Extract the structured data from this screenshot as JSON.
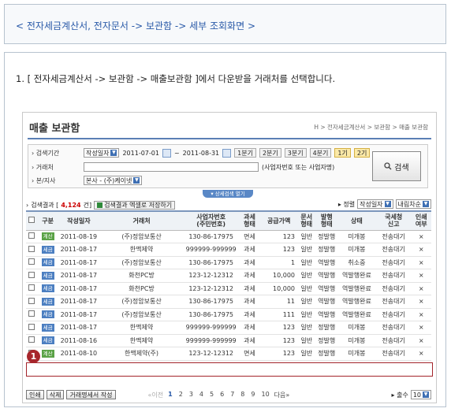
{
  "header": {
    "title": "< 전자세금계산서, 전자문서 -> 보관함 -> 세부 조회화면 >"
  },
  "instruction": "1. [ 전자세금계산서 -> 보관함 -> 매출보관함 ]에서 다운받을 거래처를 선택합니다.",
  "screen": {
    "page_title": "매출 보관함",
    "breadcrumb": "H > 전자세금계산서 > 보관함 > 매출 보관함",
    "search": {
      "period_label": "검색기간",
      "date_type": "작성일자",
      "date_from": "2011-07-01",
      "date_to": "2011-08-31",
      "range_tilde": "~",
      "ranges": [
        "1분기",
        "2분기",
        "3분기",
        "4분기",
        "1기",
        "2기"
      ],
      "partner_label": "거래처",
      "partner_value": "",
      "partner_hint": "(사업자번호 또는 사업자명)",
      "branch_label": "본/지사",
      "branch_value": "본사 - (주)케이넷",
      "search_button": "검색",
      "detail_toggle": "상세검색 열기"
    },
    "result": {
      "prefix": "검색결과 [",
      "count": "4,124",
      "suffix": "건]",
      "excel_button": "검색결과 엑셀로 저장하기",
      "sort_label": "▸ 정렬",
      "sort_value": "작성일자",
      "order_value": "내림차순"
    },
    "columns": [
      "구분",
      "작성일자",
      "거래처",
      "사업자번호\n(주민번호)",
      "과세\n형태",
      "공급가액",
      "문서\n형태",
      "발행\n형태",
      "상태",
      "국세청\n신고",
      "인쇄\n여부"
    ],
    "rows": [
      {
        "type": "계산",
        "type_color": "green",
        "date": "2011-08-19",
        "partner": "(주)정암보통산",
        "bizno": "130-86-17975",
        "tax": "면세",
        "tax_red": true,
        "amount": "123",
        "doc": "일반",
        "issue": "정발행",
        "status": "미개봉",
        "nts": "전송대기",
        "print": "×"
      },
      {
        "type": "세금",
        "type_color": "blue",
        "date": "2011-08-17",
        "partner": "한맥제약",
        "bizno": "999999-999999",
        "tax": "과세",
        "tax_red": false,
        "amount": "123",
        "doc": "일반",
        "issue": "정발행",
        "status": "미개봉",
        "nts": "전송대기",
        "print": "×"
      },
      {
        "type": "세금",
        "type_color": "blue",
        "date": "2011-08-17",
        "partner": "(주)정암보통산",
        "bizno": "130-86-17975",
        "tax": "과세",
        "tax_red": false,
        "amount": "1",
        "doc": "일반",
        "issue": "역발행",
        "status": "취소중",
        "nts": "전송대기",
        "print": "×"
      },
      {
        "type": "세금",
        "type_color": "blue",
        "date": "2011-08-17",
        "partner": "화천PC방",
        "bizno": "123-12-12312",
        "tax": "과세",
        "tax_red": false,
        "amount": "10,000",
        "doc": "일반",
        "issue": "역발행",
        "status": "역발행완료",
        "nts": "전송대기",
        "print": "×"
      },
      {
        "type": "세금",
        "type_color": "blue",
        "date": "2011-08-17",
        "partner": "화천PC방",
        "bizno": "123-12-12312",
        "tax": "과세",
        "tax_red": false,
        "amount": "10,000",
        "doc": "일반",
        "issue": "역발행",
        "status": "역발행완료",
        "nts": "전송대기",
        "print": "×"
      },
      {
        "type": "세금",
        "type_color": "blue",
        "date": "2011-08-17",
        "partner": "(주)정암보통산",
        "bizno": "130-86-17975",
        "tax": "과세",
        "tax_red": false,
        "amount": "11",
        "doc": "일반",
        "issue": "역발행",
        "status": "역발행완료",
        "nts": "전송대기",
        "print": "×"
      },
      {
        "type": "세금",
        "type_color": "blue",
        "date": "2011-08-17",
        "partner": "(주)정암보통산",
        "bizno": "130-86-17975",
        "tax": "과세",
        "tax_red": false,
        "amount": "111",
        "doc": "일반",
        "issue": "역발행",
        "status": "역발행완료",
        "nts": "전송대기",
        "print": "×"
      },
      {
        "type": "세금",
        "type_color": "blue",
        "date": "2011-08-17",
        "partner": "한맥제약",
        "bizno": "999999-999999",
        "tax": "과세",
        "tax_red": false,
        "amount": "123",
        "doc": "일반",
        "issue": "정발행",
        "status": "미개봉",
        "nts": "전송대기",
        "print": "×"
      },
      {
        "type": "세금",
        "type_color": "blue",
        "date": "2011-08-16",
        "partner": "한맥제약",
        "bizno": "999999-999999",
        "tax": "과세",
        "tax_red": false,
        "amount": "123",
        "doc": "일반",
        "issue": "정발행",
        "status": "미개봉",
        "nts": "전송대기",
        "print": "×"
      },
      {
        "type": "계산",
        "type_color": "green",
        "date": "2011-08-10",
        "partner": "한맥제약(주)",
        "bizno": "123-12-12312",
        "tax": "면세",
        "tax_red": true,
        "amount": "123",
        "doc": "일반",
        "issue": "정발행",
        "status": "미개봉",
        "nts": "전송대기",
        "print": "×"
      }
    ],
    "bottom": {
      "print_button": "인쇄",
      "delete_button": "삭제",
      "statement_button": "거래명세서 작성",
      "prev": "«이전",
      "pages": [
        "1",
        "2",
        "3",
        "4",
        "5",
        "6",
        "7",
        "8",
        "9",
        "10"
      ],
      "next": "다음»",
      "perpage_label": "▸ 출수",
      "perpage_value": "10"
    },
    "marker": "1"
  },
  "colors": {
    "accent": "#2a5aa8",
    "highlight": "#a3242a"
  }
}
